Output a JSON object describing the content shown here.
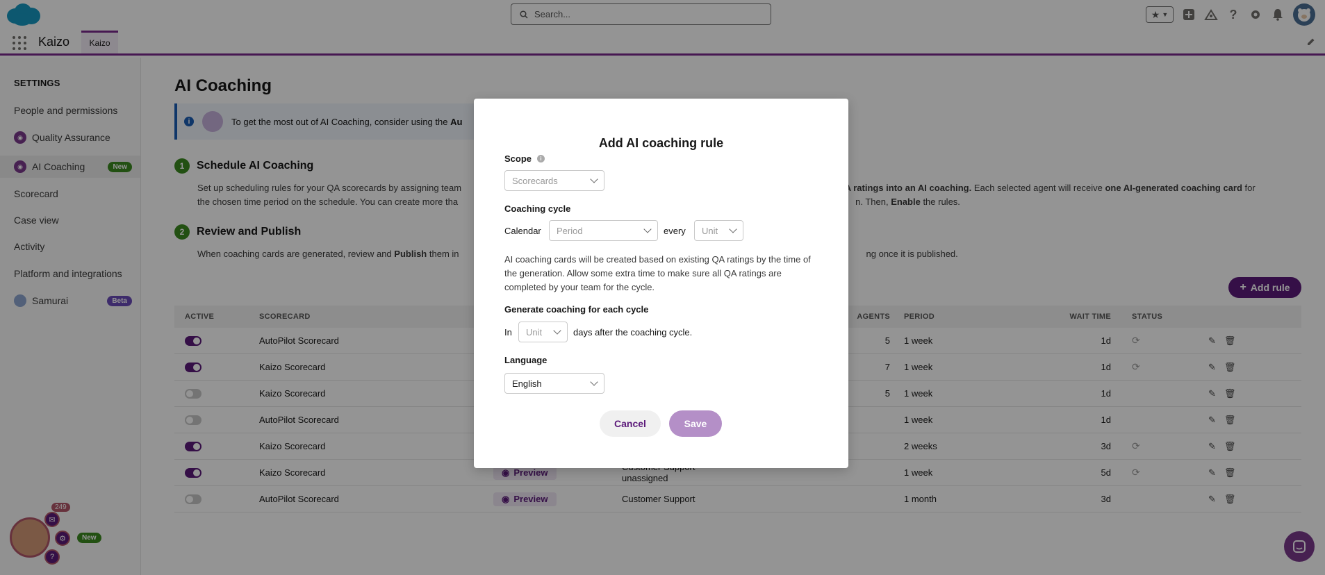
{
  "header": {
    "search_placeholder": "Search...",
    "app_name": "Kaizo",
    "app_tab": "Kaizo"
  },
  "sidebar": {
    "heading": "SETTINGS",
    "items": [
      {
        "label": "People and permissions"
      },
      {
        "label": "Quality Assurance"
      },
      {
        "label": "AI Coaching",
        "badge": "New"
      },
      {
        "label": "Scorecard"
      },
      {
        "label": "Case view"
      },
      {
        "label": "Activity"
      },
      {
        "label": "Platform and integrations"
      },
      {
        "label": "Samurai",
        "badge": "Beta"
      }
    ]
  },
  "main": {
    "title": "AI Coaching",
    "banner_text_prefix": "To get the most out of AI Coaching, consider using the",
    "banner_text_bold": "Au",
    "step1": {
      "num": "1",
      "title": "Schedule AI Coaching",
      "desc1_a": "Set up scheduling rules for your QA scorecards by assigning team",
      "desc1_bold1": "ng QA ratings into an AI coaching.",
      "desc1_b": "Each selected agent will receive",
      "desc1_bold2": "one AI-generated coaching card",
      "desc1_c": "for",
      "desc2_a": "the chosen time period on the schedule. You can create more tha",
      "desc2_b": "n. Then,",
      "desc2_bold": "Enable",
      "desc2_c": "the rules."
    },
    "step2": {
      "num": "2",
      "title": "Review and Publish",
      "desc_a": "When coaching cards are generated, review and",
      "desc_bold": "Publish",
      "desc_b": "them in",
      "desc_c": "ng once it is published."
    },
    "add_rule_label": "Add rule",
    "table": {
      "headers": {
        "active": "ACTIVE",
        "scorecard": "SCORECARD",
        "agents": "AGENTS",
        "period": "PERIOD",
        "wait": "WAIT TIME",
        "status": "STATUS"
      },
      "rows": [
        {
          "active": true,
          "scorecard": "AutoPilot Scorecard",
          "preview": "",
          "team": "",
          "team2": "",
          "agents": "5",
          "period": "1 week",
          "wait": "1d",
          "status": true
        },
        {
          "active": true,
          "scorecard": "Kaizo Scorecard",
          "preview": "",
          "team": "",
          "team2": "",
          "agents": "7",
          "period": "1 week",
          "wait": "1d",
          "status": true
        },
        {
          "active": false,
          "scorecard": "Kaizo Scorecard",
          "preview": "",
          "team": "",
          "team2": "",
          "agents": "5",
          "period": "1 week",
          "wait": "1d",
          "status": false
        },
        {
          "active": false,
          "scorecard": "AutoPilot Scorecard",
          "preview": "",
          "team": "",
          "team2": "",
          "agents": "",
          "period": "1 week",
          "wait": "1d",
          "status": false
        },
        {
          "active": true,
          "scorecard": "Kaizo Scorecard",
          "preview": "",
          "team": "",
          "team2": "",
          "agents": "",
          "period": "2 weeks",
          "wait": "3d",
          "status": true
        },
        {
          "active": true,
          "scorecard": "Kaizo Scorecard",
          "preview": "Preview",
          "team": "Customer Support",
          "team2": "unassigned",
          "agents": "",
          "period": "1 week",
          "wait": "5d",
          "status": true
        },
        {
          "active": false,
          "scorecard": "AutoPilot Scorecard",
          "preview": "Preview",
          "team": "Customer Support",
          "team2": "",
          "agents": "",
          "period": "1 month",
          "wait": "3d",
          "status": false
        }
      ]
    }
  },
  "widget": {
    "count": "249",
    "new_label": "New"
  },
  "modal": {
    "title": "Add AI coaching rule",
    "scope_label": "Scope",
    "scope_placeholder": "Scorecards",
    "cycle_label": "Coaching cycle",
    "calendar_label": "Calendar",
    "period_placeholder": "Period",
    "every_label": "every",
    "unit_placeholder": "Unit",
    "paragraph": "AI coaching cards will be created based on existing QA ratings by the time of the generation. Allow some extra time to make sure all QA ratings are completed by your team for the cycle.",
    "generate_label": "Generate coaching for each cycle",
    "in_label": "In",
    "days_unit_placeholder": "Unit",
    "days_after": "days after the coaching cycle.",
    "language_label": "Language",
    "language_value": "English",
    "cancel_label": "Cancel",
    "save_label": "Save"
  },
  "colors": {
    "brand": "#5c1a7a",
    "save_disabled": "#b48fc7",
    "overlay": "rgba(0,0,0,0.42)"
  }
}
